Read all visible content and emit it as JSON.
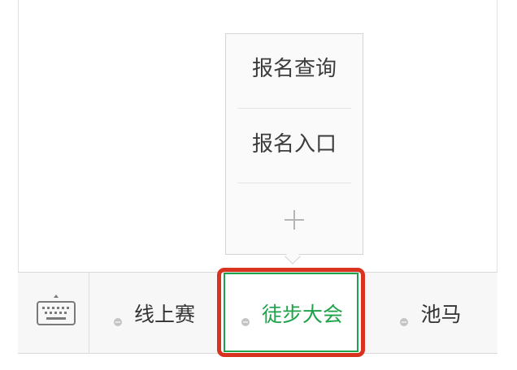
{
  "submenu": {
    "items": [
      {
        "label": "报名查询"
      },
      {
        "label": "报名入口"
      }
    ],
    "add_icon": "plus-icon"
  },
  "menubar": {
    "keyboard_icon": "keyboard-icon",
    "tabs": [
      {
        "label": "线上赛",
        "active": false
      },
      {
        "label": "徒步大会",
        "active": true
      },
      {
        "label": "池马",
        "active": false
      }
    ]
  },
  "colors": {
    "active_tab_text": "#1fa34a",
    "highlight_annotation": "#d9321f",
    "default_text": "#333333"
  }
}
